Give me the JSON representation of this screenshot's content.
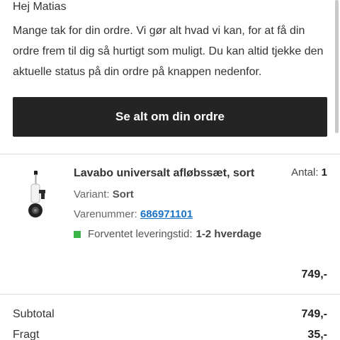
{
  "email": {
    "greeting": "Hej Matias",
    "intro": "Mange tak for din ordre. Vi gør alt hvad vi kan, for at få din ordre frem til dig så hurtigt som muligt. Du kan altid tjekke den aktuelle status på din ordre på knappen nedenfor.",
    "cta_label": "Se alt om din ordre"
  },
  "order_item": {
    "name": "Lavabo universalt afløbssæt, sort",
    "quantity_label": "Antal:",
    "quantity": "1",
    "variant_label": "Variant:",
    "variant": "Sort",
    "sku_label": "Varenummer:",
    "sku": "686971101",
    "delivery_label": "Forventet leveringstid:",
    "delivery_time": "1-2 hverdage",
    "delivery_status_color": "#3bb54a",
    "price": "749,-",
    "image_icon": "drain-set-product-image"
  },
  "summary": {
    "subtotal_label": "Subtotal",
    "subtotal": "749,-",
    "shipping_label": "Fragt",
    "shipping": "35,-"
  },
  "colors": {
    "button_bg": "#242424",
    "link": "#1a73c8"
  }
}
